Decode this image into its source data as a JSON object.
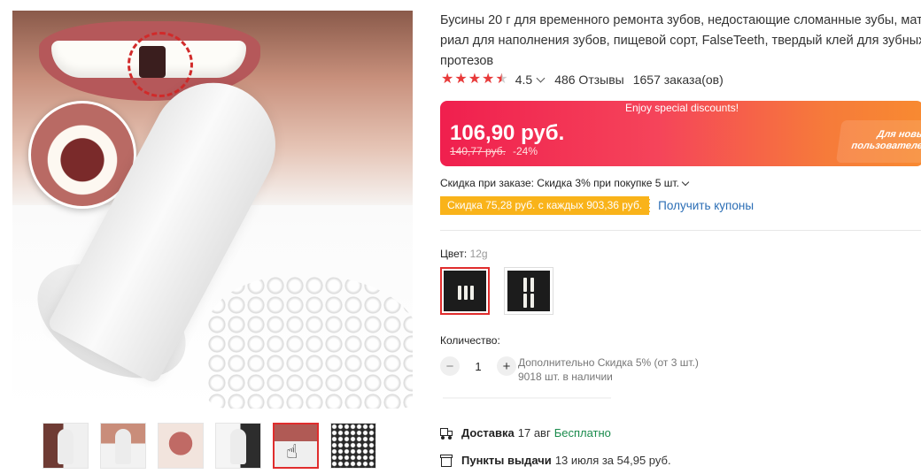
{
  "product": {
    "title_lines": [
      "Бусины 20 г для временного ремонта зубов, недостающие сломанные зубы, мате",
      "риал для наполнения зубов, пищевой сорт, FalseTeeth, твердый клей для зубных",
      "протезов"
    ]
  },
  "rating": {
    "value": "4.5",
    "stars": 4.5,
    "reviews": "486 Отзывы",
    "orders": "1657 заказа(ов)"
  },
  "price": {
    "banner": "Enjoy special discounts!",
    "current": "106,90 руб.",
    "old": "140,77 руб.",
    "discount": "-24%",
    "promo_line1": "Для новых",
    "promo_line2": "пользователей"
  },
  "order_discount": {
    "text": "Скидка при заказе: Скидка 3% при покупке 5 шт."
  },
  "coupon": {
    "tag": "Скидка 75,28 руб. с каждых 903,36 руб.",
    "link": "Получить купоны"
  },
  "color": {
    "label": "Цвет:",
    "value": "12g"
  },
  "quantity": {
    "label": "Количество:",
    "minus": "−",
    "value": "1",
    "plus": "+",
    "extra_discount": "Дополнительно Скидка 5% (от 3 шт.)",
    "stock": "9018 шт. в наличии"
  },
  "delivery": {
    "label": "Доставка",
    "date": "17 авг",
    "cost": "Бесплатно"
  },
  "pickup": {
    "label": "Пункты выдачи",
    "details": "13 июля за 54,95 руб."
  },
  "colors": {
    "accent": "#e02d2d",
    "price_gradient_start": "#f01f4e",
    "price_gradient_end": "#f88a31",
    "coupon": "#f9b31a",
    "link": "#2a6db5",
    "free": "#1a8b4c"
  }
}
